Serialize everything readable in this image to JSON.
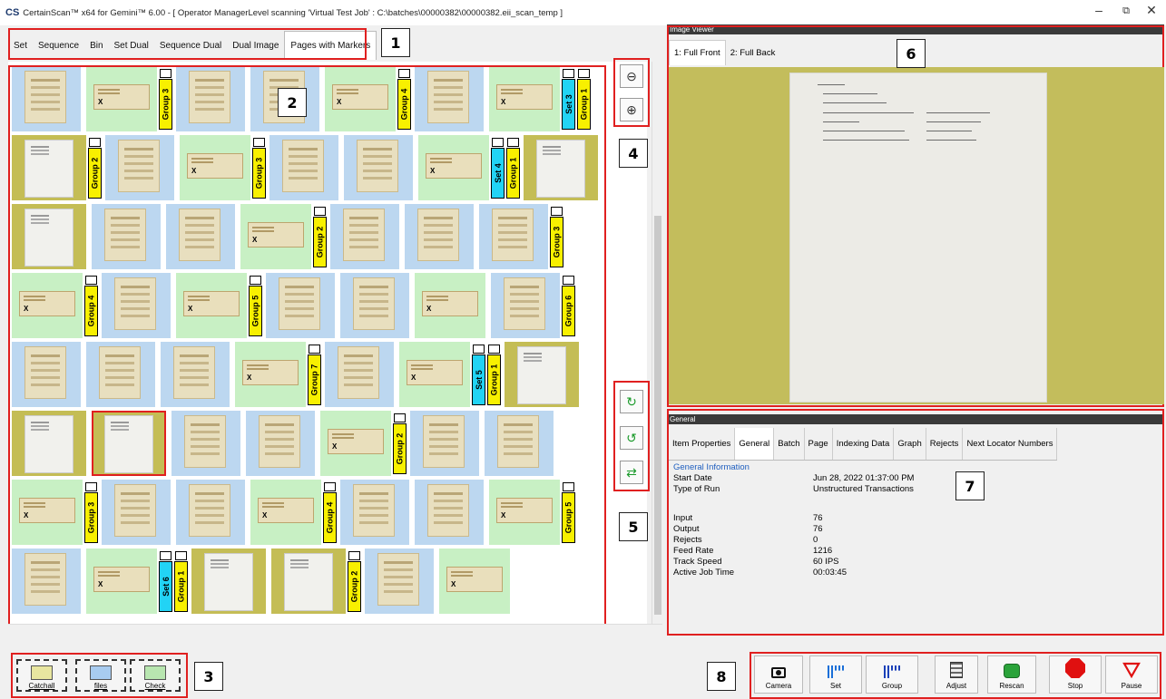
{
  "window": {
    "logo": "CS",
    "title": "CertainScan™ x64 for Gemini™ 6.00 - [ Operator ManagerLevel scanning 'Virtual Test Job' : C:\\batches\\00000382\\00000382.eii_scan_temp ]",
    "min": "–",
    "restore": "⧉",
    "close": "✕"
  },
  "view_tabs": [
    "Set",
    "Sequence",
    "Bin",
    "Set Dual",
    "Sequence Dual",
    "Dual Image",
    "Pages with Markers"
  ],
  "active_view_tab": "Pages with Markers",
  "callouts": [
    "1",
    "2",
    "3",
    "4",
    "5",
    "6",
    "7",
    "8"
  ],
  "zoom": {
    "out_icon": "⊖",
    "in_icon": "⊕"
  },
  "rotate_icons": [
    "↻",
    "↺",
    "⇄"
  ],
  "bins": [
    {
      "label": "Catchall",
      "color": "#e8e6a0"
    },
    {
      "label": "files",
      "color": "#a8ccf0"
    },
    {
      "label": "Check",
      "color": "#b8e6b0"
    }
  ],
  "image_viewer": {
    "header": "Image Viewer",
    "tabs": [
      "1: Full Front",
      "2: Full Back"
    ]
  },
  "general_panel": {
    "header": "General",
    "tabs": [
      "Item Properties",
      "General",
      "Batch",
      "Page",
      "Indexing Data",
      "Graph",
      "Rejects",
      "Next Locator Numbers"
    ],
    "section_title": "General Information",
    "rows": [
      {
        "label": "Start Date",
        "value": "Jun 28, 2022 01:37:00 PM"
      },
      {
        "label": "Type of Run",
        "value": "Unstructured Transactions"
      },
      {
        "label": "",
        "value": ""
      },
      {
        "label": "Input",
        "value": "76"
      },
      {
        "label": "Output",
        "value": "76"
      },
      {
        "label": "Rejects",
        "value": "0"
      },
      {
        "label": "Feed Rate",
        "value": "1216"
      },
      {
        "label": "Track Speed",
        "value": "60 IPS"
      },
      {
        "label": "Active Job Time",
        "value": "00:03:45"
      }
    ]
  },
  "controls": [
    {
      "label": "Camera",
      "icon": "camera-icon"
    },
    {
      "label": "Set",
      "icon": "set-icon"
    },
    {
      "label": "Group",
      "icon": "group-icon"
    },
    {
      "label": "Adjust",
      "icon": "adjust-icon"
    },
    {
      "label": "Rescan",
      "icon": "rescan-icon"
    },
    {
      "label": "Stop",
      "icon": "stop-icon"
    },
    {
      "label": "Pause",
      "icon": "pause-icon"
    }
  ],
  "thumb_rows": [
    [
      {
        "t": "doc"
      },
      {
        "t": "check",
        "m": [
          {
            "k": "group",
            "label": "Group 3"
          }
        ]
      },
      {
        "t": "doc"
      },
      {
        "t": "doc"
      },
      {
        "t": "check",
        "m": [
          {
            "k": "group",
            "label": "Group 4"
          }
        ]
      },
      {
        "t": "doc"
      },
      {
        "t": "check",
        "m": [
          {
            "k": "set",
            "label": "Set 3"
          },
          {
            "k": "group",
            "label": "Group 1"
          }
        ]
      }
    ],
    [
      {
        "t": "sep",
        "m": [
          {
            "k": "group",
            "label": "Group 2"
          }
        ]
      },
      {
        "t": "doc"
      },
      {
        "t": "check",
        "m": [
          {
            "k": "group",
            "label": "Group 3"
          }
        ]
      },
      {
        "t": "doc"
      },
      {
        "t": "doc"
      },
      {
        "t": "check",
        "m": [
          {
            "k": "set",
            "label": "Set 4"
          },
          {
            "k": "group",
            "label": "Group 1"
          }
        ]
      },
      {
        "t": "sep"
      }
    ],
    [
      {
        "t": "sep"
      },
      {
        "t": "doc"
      },
      {
        "t": "doc"
      },
      {
        "t": "check",
        "m": [
          {
            "k": "group",
            "label": "Group 2"
          }
        ]
      },
      {
        "t": "doc"
      },
      {
        "t": "doc"
      },
      {
        "t": "doc",
        "m": [
          {
            "k": "group",
            "label": "Group 3"
          }
        ]
      }
    ],
    [
      {
        "t": "check",
        "m": [
          {
            "k": "group",
            "label": "Group 4"
          }
        ]
      },
      {
        "t": "doc"
      },
      {
        "t": "check",
        "m": [
          {
            "k": "group",
            "label": "Group 5"
          }
        ]
      },
      {
        "t": "doc"
      },
      {
        "t": "doc"
      },
      {
        "t": "check"
      },
      {
        "t": "doc",
        "m": [
          {
            "k": "group",
            "label": "Group 6"
          }
        ]
      }
    ],
    [
      {
        "t": "doc"
      },
      {
        "t": "doc"
      },
      {
        "t": "doc"
      },
      {
        "t": "check",
        "m": [
          {
            "k": "group",
            "label": "Group 7"
          }
        ]
      },
      {
        "t": "doc"
      },
      {
        "t": "check",
        "m": [
          {
            "k": "set",
            "label": "Set 5"
          },
          {
            "k": "group",
            "label": "Group 1"
          }
        ]
      },
      {
        "t": "sep"
      }
    ],
    [
      {
        "t": "sep"
      },
      {
        "t": "sep",
        "sel": true
      },
      {
        "t": "doc"
      },
      {
        "t": "doc"
      },
      {
        "t": "check",
        "m": [
          {
            "k": "group",
            "label": "Group 2"
          }
        ]
      },
      {
        "t": "doc"
      },
      {
        "t": "doc"
      }
    ],
    [
      {
        "t": "check",
        "m": [
          {
            "k": "group",
            "label": "Group 3"
          }
        ]
      },
      {
        "t": "doc"
      },
      {
        "t": "doc"
      },
      {
        "t": "check",
        "m": [
          {
            "k": "group",
            "label": "Group 4"
          }
        ]
      },
      {
        "t": "doc"
      },
      {
        "t": "doc"
      },
      {
        "t": "check",
        "m": [
          {
            "k": "group",
            "label": "Group 5"
          }
        ]
      }
    ],
    [
      {
        "t": "doc"
      },
      {
        "t": "check",
        "m": [
          {
            "k": "set",
            "label": "Set 6"
          },
          {
            "k": "group",
            "label": "Group 1"
          }
        ]
      },
      {
        "t": "sep"
      },
      {
        "t": "sep",
        "m": [
          {
            "k": "group",
            "label": "Group 2"
          }
        ]
      },
      {
        "t": "doc"
      },
      {
        "t": "check"
      }
    ]
  ]
}
